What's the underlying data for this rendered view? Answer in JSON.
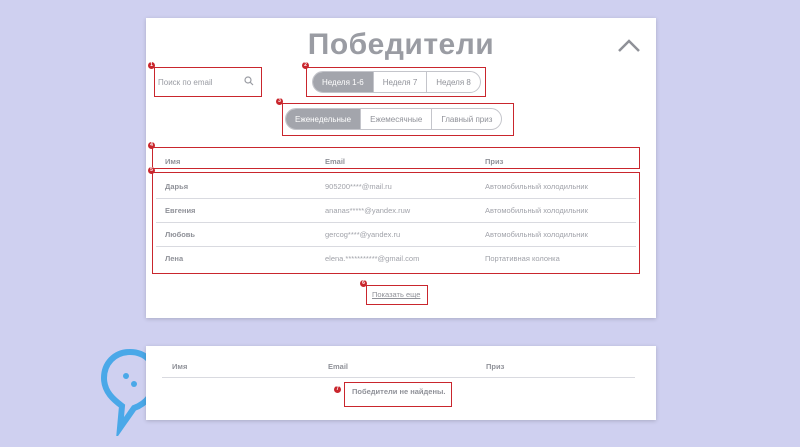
{
  "header": {
    "title": "Победители"
  },
  "search": {
    "placeholder": "Поиск по email"
  },
  "weeks_filter": {
    "options": [
      "Неделя 1-6",
      "Неделя 7",
      "Неделя 8"
    ],
    "active": 0
  },
  "period_filter": {
    "options": [
      "Еженедельные",
      "Ежемесячные",
      "Главный приз"
    ],
    "active": 0
  },
  "table": {
    "headers": {
      "name": "Имя",
      "email": "Email",
      "prize": "Приз"
    },
    "rows": [
      {
        "name": "Дарья",
        "email": "905200****@mail.ru",
        "prize": "Автомобильный холодильник"
      },
      {
        "name": "Евгения",
        "email": "ananas*****@yandex.ruw",
        "prize": "Автомобильный холодильник"
      },
      {
        "name": "Любовь",
        "email": "gercog****@yandex.ru",
        "prize": "Автомобильный холодильник"
      },
      {
        "name": "Лена",
        "email": "elena.***********@gmail.com",
        "prize": "Портативная колонка"
      }
    ]
  },
  "show_more": {
    "label": "Показать еще"
  },
  "empty_state": {
    "headers": {
      "name": "Имя",
      "email": "Email",
      "prize": "Приз"
    },
    "message": "Победители не найдены."
  },
  "annotations": [
    "1",
    "2",
    "3",
    "4",
    "5",
    "6",
    "7"
  ],
  "colors": {
    "accent_active": "#a3a5ac",
    "annotation": "#c9262d",
    "background": "#cfd0f0",
    "logo": "#4aa8e8"
  },
  "icons": {
    "search": "search-icon",
    "collapse": "chevron-up-icon",
    "logo": "brand-logo-icon"
  }
}
